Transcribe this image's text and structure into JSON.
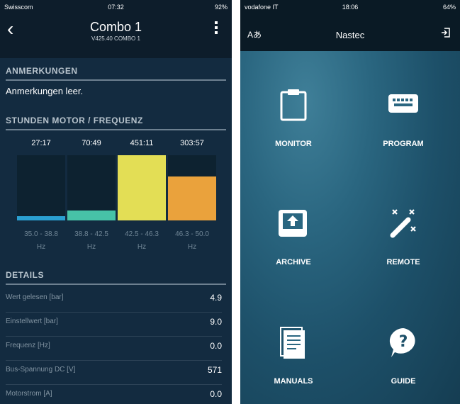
{
  "left": {
    "status": {
      "carrier": "Swisscom",
      "time": "07:32",
      "battery": "92%"
    },
    "nav": {
      "title": "Combo 1",
      "subtitle": "V425.40 COMBO 1"
    },
    "notes": {
      "header": "ANMERKUNGEN",
      "text": "Anmerkungen leer."
    },
    "chart_section": {
      "header": "STUNDEN MOTOR / FREQUENZ"
    },
    "details": {
      "header": "DETAILS",
      "rows": [
        {
          "label": "Wert gelesen [bar]",
          "value": "4.9"
        },
        {
          "label": "Einstellwert [bar]",
          "value": "9.0"
        },
        {
          "label": "Frequenz [Hz]",
          "value": "0.0"
        },
        {
          "label": "Bus-Spannung DC [V]",
          "value": "571"
        },
        {
          "label": "Motorstrom [A]",
          "value": "0.0"
        }
      ]
    }
  },
  "chart_data": {
    "type": "bar",
    "categories": [
      "35.0 - 38.8 Hz",
      "38.8 - 42.5 Hz",
      "42.5 - 46.3 Hz",
      "46.3 - 50.0 Hz"
    ],
    "category_lines": [
      [
        "35.0 - 38.8",
        "Hz"
      ],
      [
        "38.8 - 42.5",
        "Hz"
      ],
      [
        "42.5 - 46.3",
        "Hz"
      ],
      [
        "46.3 - 50.0",
        "Hz"
      ]
    ],
    "value_labels": [
      "27:17",
      "70:49",
      "451:11",
      "303:57"
    ],
    "values": [
      27.28,
      70.82,
      451.18,
      303.95
    ],
    "ylim": [
      0,
      451.18
    ],
    "colors": [
      "#2a9fd0",
      "#47c2a7",
      "#e3de55",
      "#eaa23c"
    ]
  },
  "right": {
    "status": {
      "carrier": "vodafone IT",
      "time": "18:06",
      "battery": "64%"
    },
    "header": {
      "lang_label": "Aあ",
      "title": "Nastec"
    },
    "tiles": {
      "monitor": "MONITOR",
      "program": "PROGRAM",
      "archive": "ARCHIVE",
      "remote": "REMOTE",
      "manuals": "MANUALS",
      "guide": "GUIDE"
    }
  }
}
